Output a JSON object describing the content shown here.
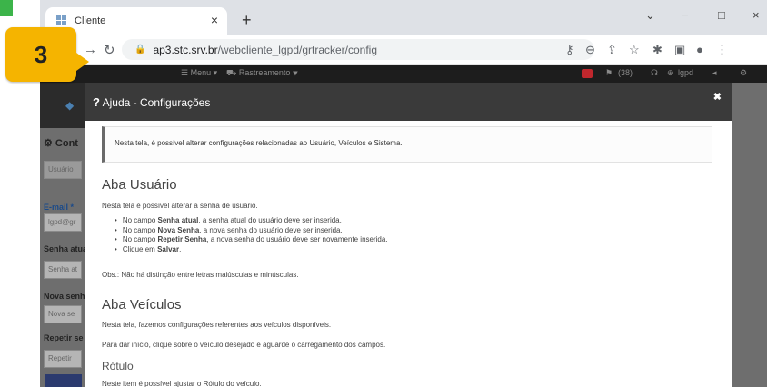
{
  "browser": {
    "tab_title": "Cliente",
    "tab_close": "×",
    "new_tab": "+",
    "url_host": "ap3.stc.srv.br",
    "url_path": "/webcliente_lgpd/grtracker/config",
    "window_controls": [
      "⌄",
      "−",
      "□",
      "×"
    ]
  },
  "step_badge": {
    "number": "3",
    "color": "#f5b400"
  },
  "app_bar": {
    "menu": "☰ Menu ▾",
    "rastreamento": "⛟ Rastreamento ▾",
    "count": "(38)",
    "user": "lgpd"
  },
  "backdrop": {
    "section_title": "Cont",
    "tab_usuario": "Usuário",
    "email_label": "E-mail *",
    "email_value": "lgpd@gr",
    "senha_atual_label": "Senha atual",
    "senha_atual_placeholder": "Senha at",
    "nova_senha_label": "Nova senha",
    "nova_senha_placeholder": "Nova se",
    "repetir_label": "Repetir se",
    "repetir_placeholder": "Repetir"
  },
  "modal": {
    "title": "Ajuda - Configurações",
    "close": "✖",
    "intro": "Nesta tela, é possível alterar configurações relacionadas ao Usuário, Veículos e Sistema.",
    "usuario": {
      "heading": "Aba Usuário",
      "description": "Nesta tela é possível alterar a senha de usuário.",
      "items": [
        {
          "pre": "No campo ",
          "bold": "Senha atual",
          "post": ", a senha atual do usuário deve ser inserida."
        },
        {
          "pre": "No campo ",
          "bold": "Nova Senha",
          "post": ", a nova senha do usuário deve ser inserida."
        },
        {
          "pre": "No campo ",
          "bold": "Repetir Senha",
          "post": ", a nova senha do usuário deve ser novamente inserida."
        },
        {
          "pre": "Clique em ",
          "bold": "Salvar",
          "post": "."
        }
      ],
      "note": "Obs.: Não há distinção entre letras maiúsculas e minúsculas."
    },
    "veiculos": {
      "heading": "Aba Veículos",
      "description": "Nesta tela, fazemos configurações referentes aos veículos disponíveis.",
      "instruction": "Para dar início, clique sobre o veículo desejado e aguarde o carregamento dos campos.",
      "subheading": "Rótulo",
      "subtext": "Neste item é possível ajustar o Rótulo do veículo."
    }
  }
}
